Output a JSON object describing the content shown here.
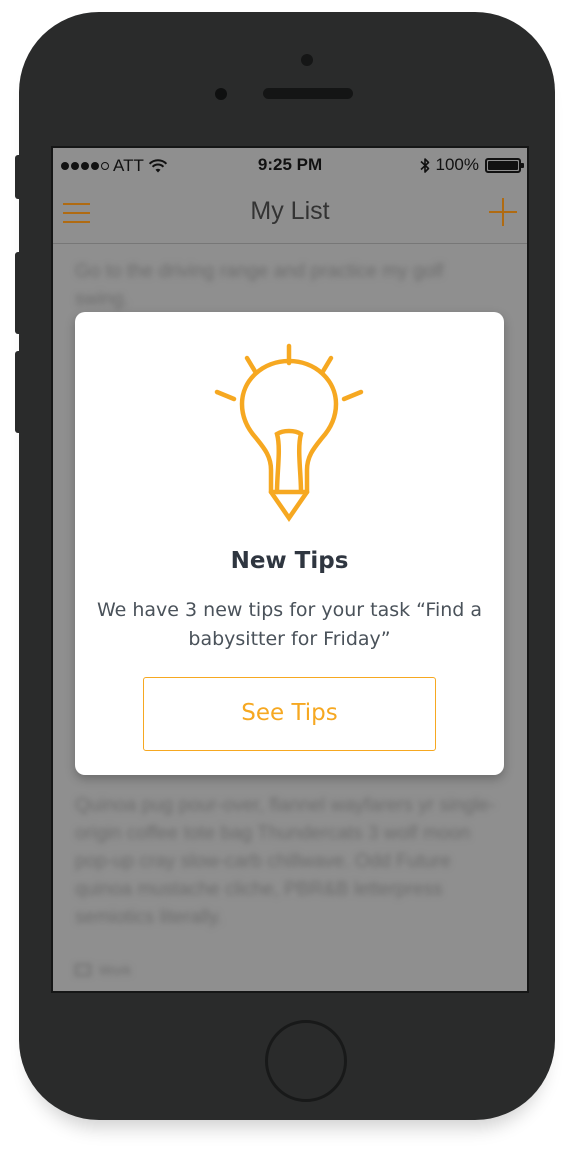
{
  "status_bar": {
    "carrier": "ATT",
    "time": "9:25 PM",
    "battery": "100%",
    "battery_level": 1.0,
    "signal_bars": 4
  },
  "nav": {
    "title": "My List",
    "menu_icon": "hamburger-menu-icon",
    "add_icon": "plus-icon",
    "accent_color": "#f6a821"
  },
  "list": {
    "items": [
      {
        "text": "Go to the driving range and practice my golf swing."
      },
      {
        "text": "Quinoa pug pour-over, flannel wayfarers yr single-origin coffee tote bag Thundercats 3 wolf moon pop-up cray slow-carb chillwave. Odd Future quinoa mustache cliche, PBR&B letterpress semiotics literally.",
        "tag": "Work"
      }
    ]
  },
  "modal": {
    "icon": "lightbulb-icon",
    "title": "New Tips",
    "body": "We have 3 new tips for your task “Find a babysitter for Friday”",
    "button_label": "See Tips"
  }
}
